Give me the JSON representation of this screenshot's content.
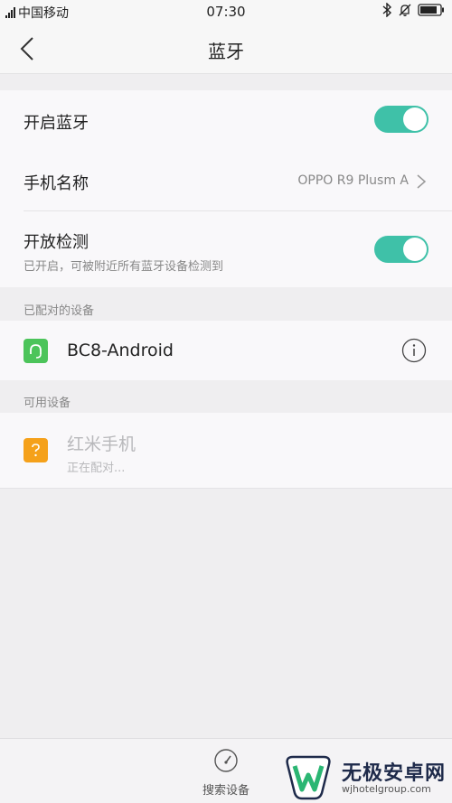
{
  "status_bar": {
    "carrier": "中国移动",
    "time": "07:30"
  },
  "nav": {
    "title": "蓝牙"
  },
  "bluetooth_toggle": {
    "label": "开启蓝牙",
    "on": true
  },
  "phone_name": {
    "label": "手机名称",
    "value": "OPPO R9 Plusm A"
  },
  "open_detection": {
    "label": "开放检测",
    "subtitle": "已开启，可被附近所有蓝牙设备检测到",
    "on": true
  },
  "paired_section": {
    "header": "已配对的设备",
    "devices": [
      {
        "name": "BC8-Android",
        "icon": "headset-icon",
        "color": "#4cc45a"
      }
    ]
  },
  "available_section": {
    "header": "可用设备",
    "devices": [
      {
        "name": "红米手机",
        "status": "正在配对...",
        "icon": "question-icon",
        "color": "#f5a11a"
      }
    ]
  },
  "bottom_bar": {
    "search_label": "搜索设备"
  },
  "watermark": {
    "title": "无极安卓网",
    "url": "wjhotelgroup.com"
  },
  "colors": {
    "accent": "#3fc1a8",
    "background": "#efeef0",
    "card": "#f9f8fa"
  }
}
